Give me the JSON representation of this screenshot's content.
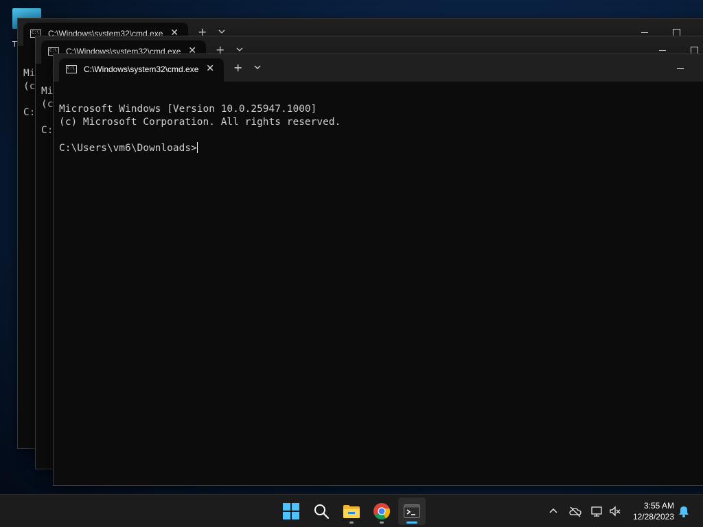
{
  "desktop": {
    "icon_label": "T"
  },
  "windows": [
    {
      "tab_title": "C:\\Windows\\system32\\cmd.exe",
      "console_lines": [
        "Mi",
        "(c",
        "",
        "C:"
      ]
    },
    {
      "tab_title": "C:\\Windows\\system32\\cmd.exe",
      "console_lines": [
        "Mi",
        "(c",
        "",
        "C:"
      ]
    },
    {
      "tab_title": "C:\\Windows\\system32\\cmd.exe",
      "console_lines": [
        "Microsoft Windows [Version 10.0.25947.1000]",
        "(c) Microsoft Corporation. All rights reserved.",
        "",
        "C:\\Users\\vm6\\Downloads>"
      ]
    }
  ],
  "tab_controls": {
    "close_glyph": "✕",
    "new_tab_glyph": "+"
  },
  "taskbar": {
    "apps": [
      {
        "name": "start",
        "icon": "windows-logo-icon"
      },
      {
        "name": "search",
        "icon": "search-icon"
      },
      {
        "name": "file-explorer",
        "icon": "folder-icon",
        "running": true
      },
      {
        "name": "chrome",
        "icon": "chrome-icon",
        "running": true
      },
      {
        "name": "terminal",
        "icon": "terminal-icon",
        "running": true,
        "active": true
      }
    ],
    "clock": {
      "time": "3:55 AM",
      "date": "12/28/2023"
    }
  },
  "colors": {
    "accent": "#4cc2ff",
    "console_text": "#cccccc",
    "console_bg": "#0c0c0c",
    "titlebar_bg": "#202020",
    "taskbar_bg": "#1c1c1c"
  }
}
